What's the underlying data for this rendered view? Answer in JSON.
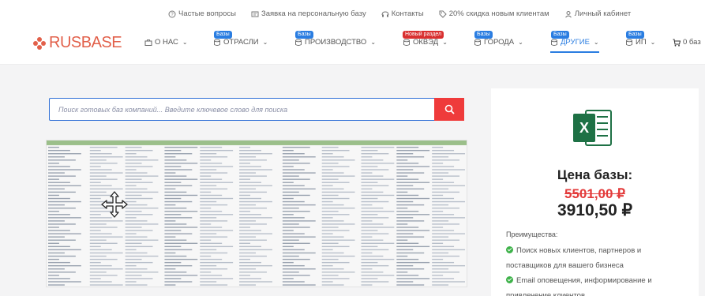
{
  "topbar": {
    "links": [
      {
        "label": "Частые вопросы",
        "icon": "question-icon"
      },
      {
        "label": "Заявка на персональную базу",
        "icon": "form-icon"
      },
      {
        "label": "Контакты",
        "icon": "contacts-icon"
      },
      {
        "label": "20% скидка новым клиентам",
        "icon": "tag-icon"
      },
      {
        "label": "Личный кабинет",
        "icon": "user-icon"
      }
    ]
  },
  "logo": {
    "text": "RUSBASE",
    "color": "#e2604a"
  },
  "nav": {
    "items": [
      {
        "label": "О НАС",
        "badge": ""
      },
      {
        "label": "ОТРАСЛИ",
        "badge": "Базы"
      },
      {
        "label": "ПРОИЗВОДСТВО",
        "badge": "Базы"
      },
      {
        "label": "ОКВЭД",
        "badge": "Новый раздел"
      },
      {
        "label": "ГОРОДА",
        "badge": "Базы"
      },
      {
        "label": "ДРУГИЕ",
        "badge": "Базы"
      },
      {
        "label": "ИП",
        "badge": "Базы"
      }
    ],
    "cart_label": "0 баз"
  },
  "search": {
    "placeholder": "Поиск готовых баз компаний... Введите ключевое слово для поиска",
    "value": ""
  },
  "card": {
    "price_label": "Цена базы:",
    "old_price": "5501,00 ₽",
    "new_price": "3910,50 ₽",
    "advantages_title": "Преимущества:",
    "advantages": [
      "Поиск новых клиентов, партнеров и поставщиков для вашего бизнеса",
      "Email оповещения, информирование и привлечение клиентов"
    ]
  },
  "colors": {
    "accent": "#2a7de1",
    "search_button": "#ef3b3b",
    "old_price": "#e33b3b",
    "check": "#3eb24a",
    "excel": "#1e7145"
  }
}
